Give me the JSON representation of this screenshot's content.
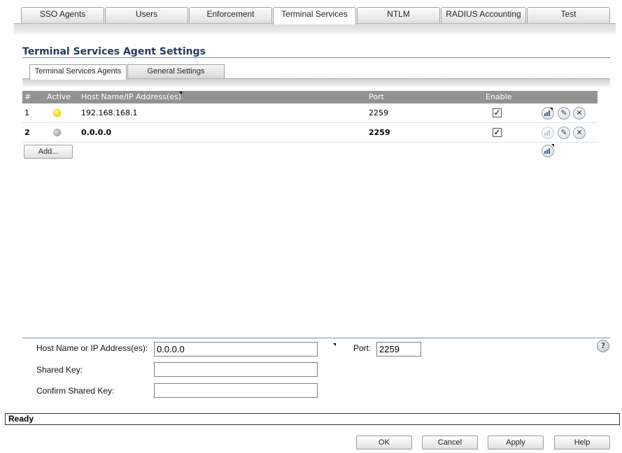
{
  "top_tabs": [
    "SSO Agents",
    "Users",
    "Enforcement",
    "Terminal Services",
    "NTLM",
    "RADIUS Accounting",
    "Test"
  ],
  "active_top_tab": "Terminal Services",
  "page_title": "Terminal Services Agent Settings",
  "sub_tabs": [
    "Terminal Services Agents",
    "General Settings"
  ],
  "active_sub_tab": "Terminal Services Agents",
  "table": {
    "headers": [
      "#",
      "Active",
      "Host Name/IP Address(es)",
      "Port",
      "Enable"
    ],
    "rows": [
      {
        "num": "1",
        "active": "on",
        "host": "192.168.168.1",
        "port": "2259",
        "enabled": true
      },
      {
        "num": "2",
        "active": "off",
        "host": "0.0.0.0",
        "port": "2259",
        "enabled": true
      }
    ],
    "add_label": "Add..."
  },
  "form": {
    "host_label": "Host Name or IP Address(es):",
    "host_value": "0.0.0.0",
    "port_label": "Port:",
    "port_value": "2259",
    "shared_key_label": "Shared Key:",
    "shared_key_value": "",
    "confirm_key_label": "Confirm Shared Key:",
    "confirm_key_value": "",
    "help_glyph": "?"
  },
  "status_text": "Ready",
  "footer_buttons": {
    "ok": "OK",
    "cancel": "Cancel",
    "apply": "Apply",
    "help": "Help"
  },
  "icons": {
    "stats": "statistics-icon",
    "edit": "pencil-icon",
    "delete": "close-icon",
    "active_on": "led-yellow",
    "active_off": "led-gray"
  }
}
